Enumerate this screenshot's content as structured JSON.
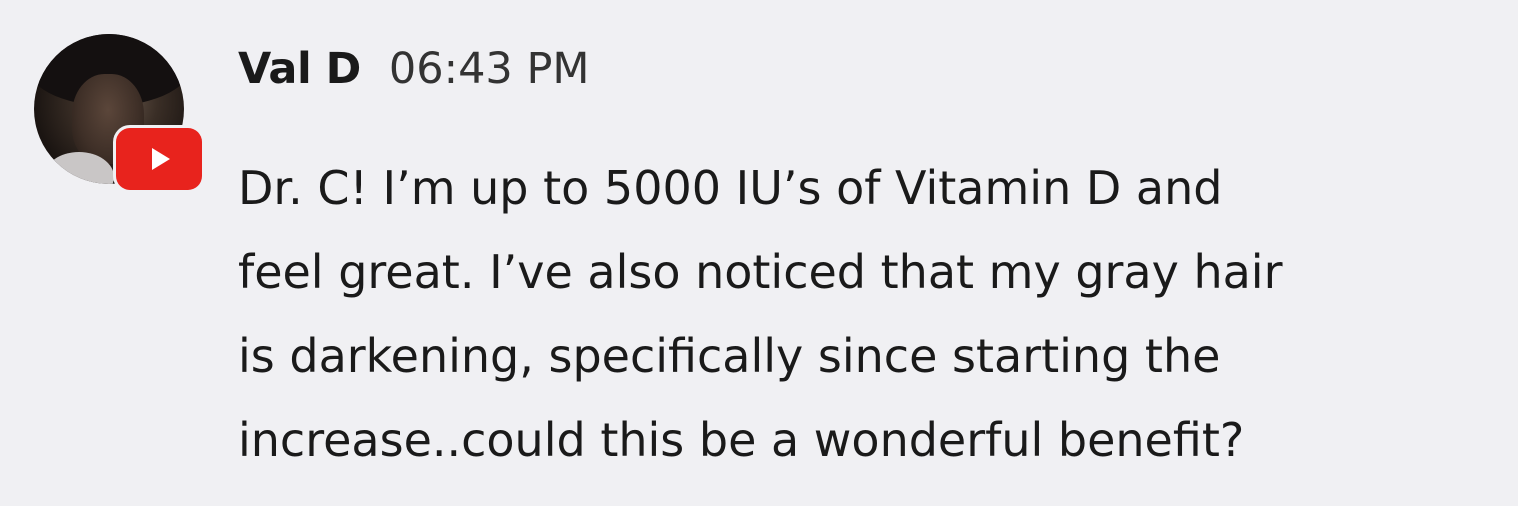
{
  "comment": {
    "author": "Val D",
    "timestamp": "06:43 PM",
    "message_lines": [
      "Dr. C! I’m up to 5000 IU’s of Vitamin D and",
      "feel great. I’ve also noticed that my gray hair",
      "is darkening, specifically since starting the",
      "increase..could this be a wonderful benefit?"
    ],
    "avatar_icon": "user-avatar",
    "platform_badge_icon": "youtube-play-icon"
  },
  "colors": {
    "background": "#f0f0f3",
    "text": "#1a1a1a",
    "badge": "#e8231d"
  }
}
